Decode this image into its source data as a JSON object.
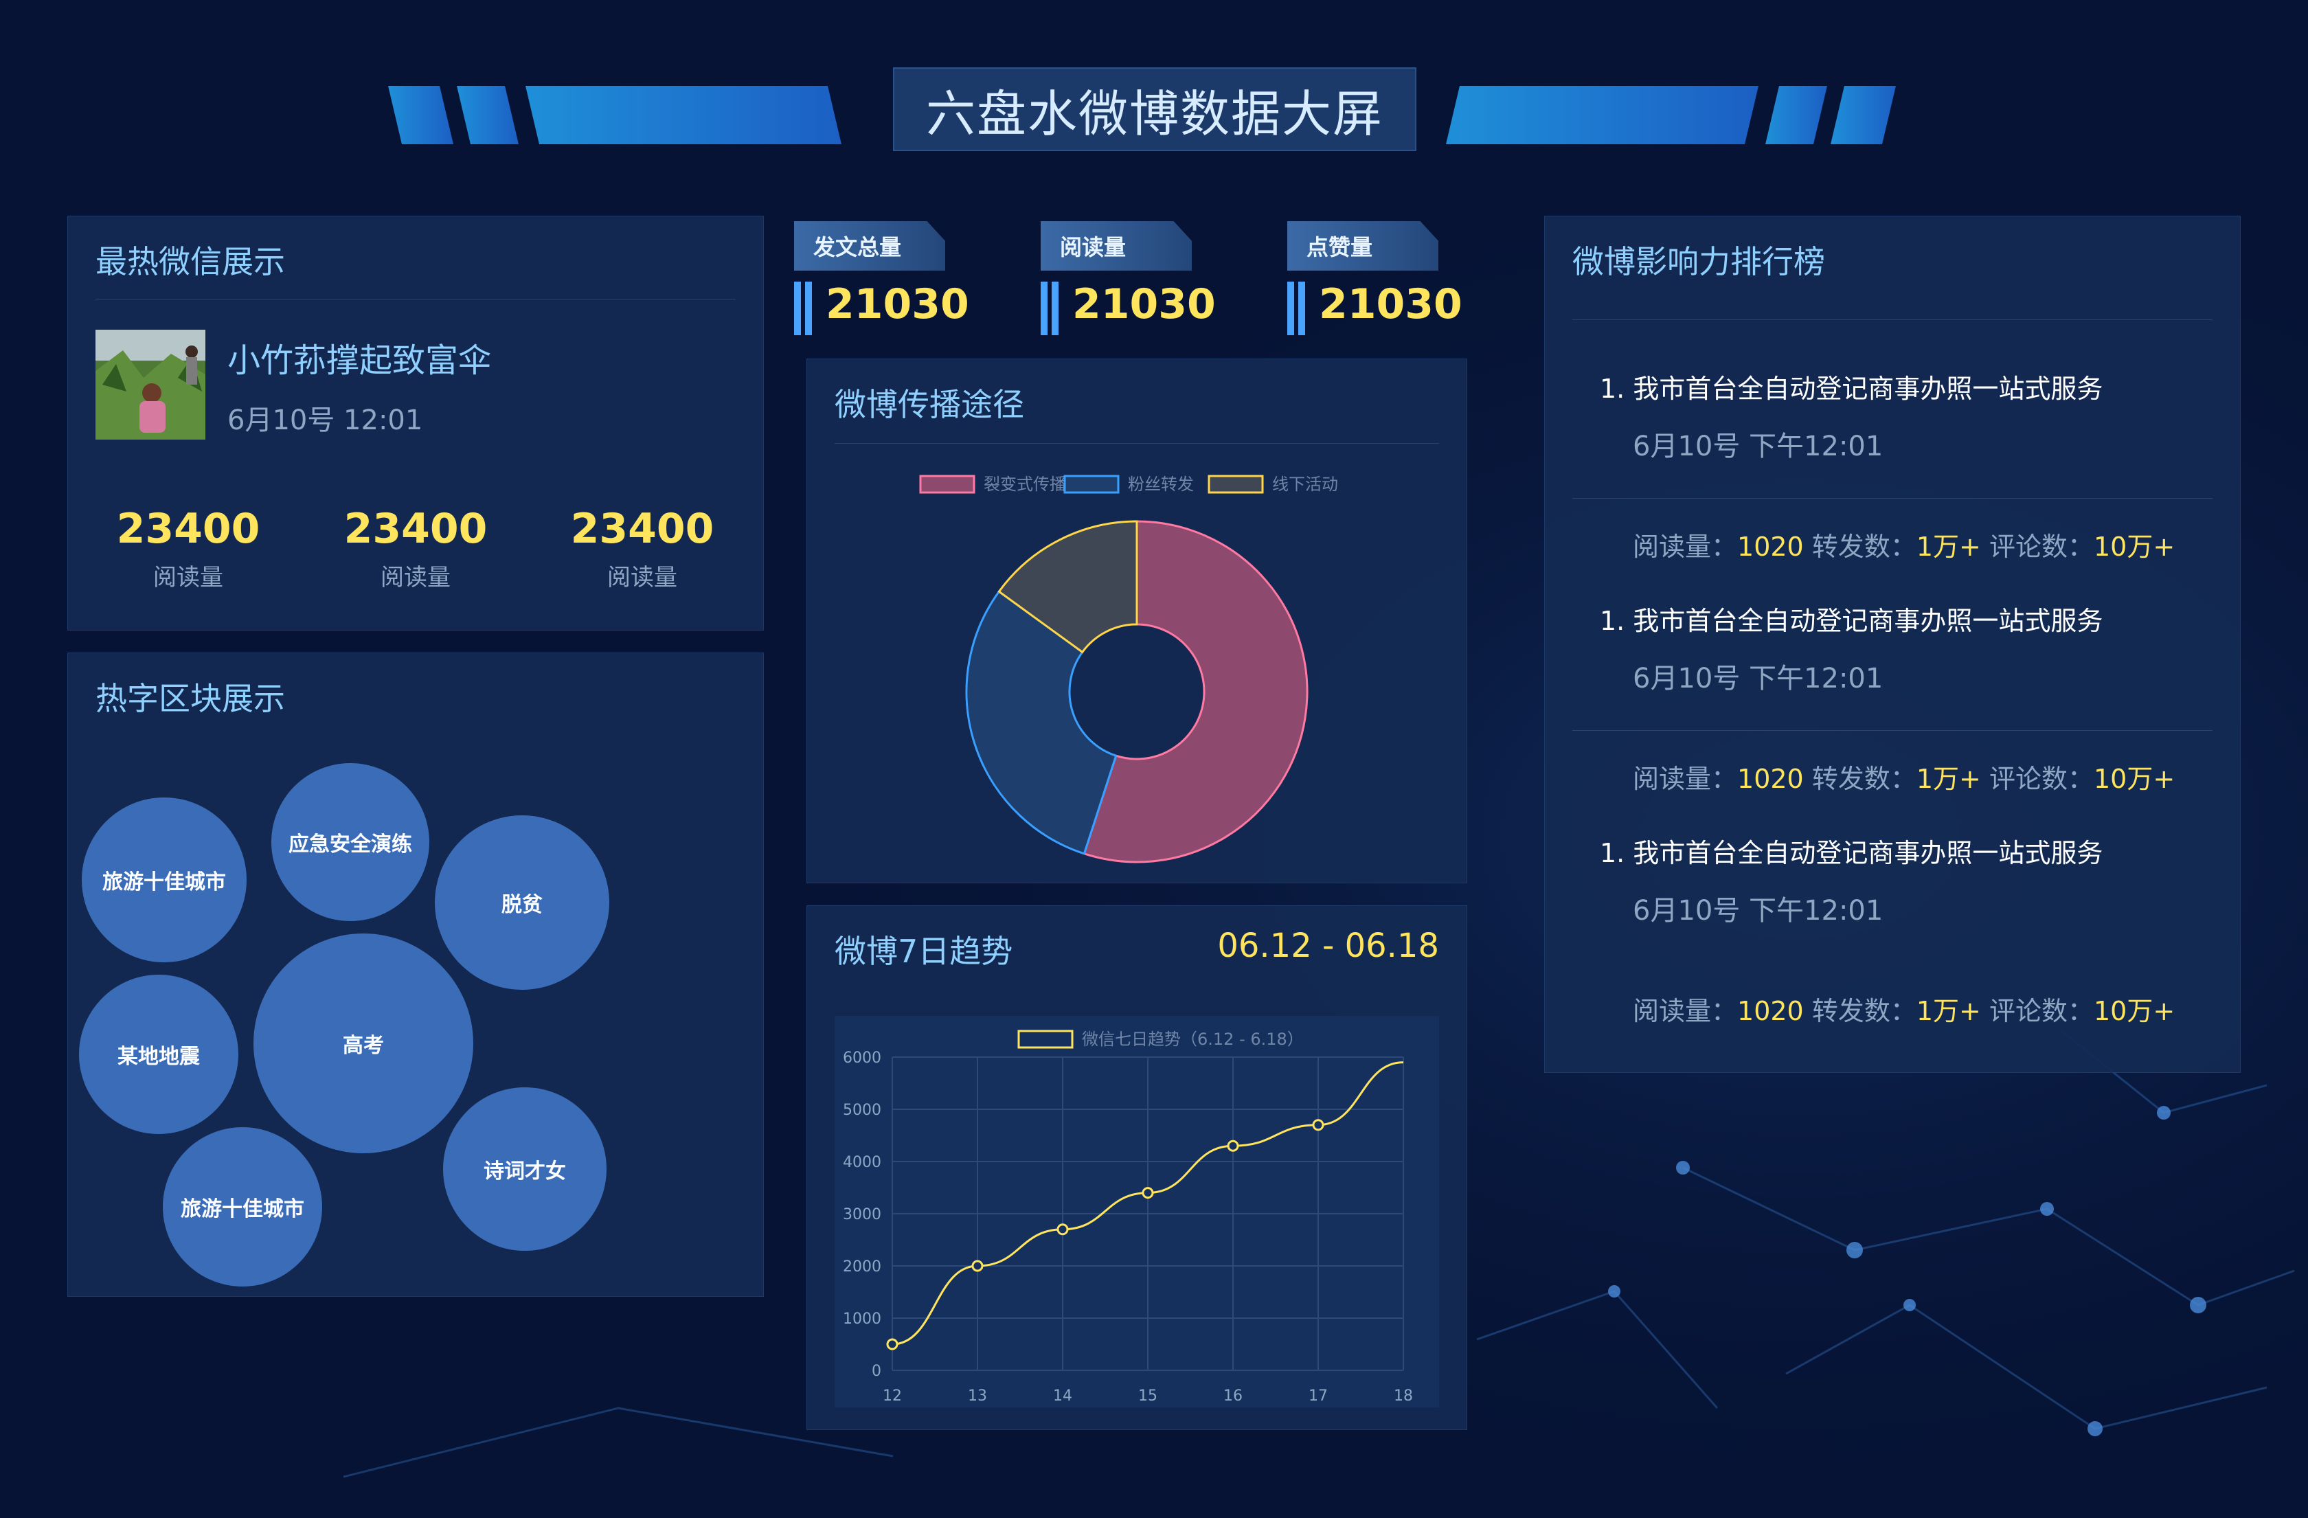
{
  "page": {
    "title": "六盘水微博数据大屏"
  },
  "hot_weixin": {
    "title": "最热微信展示",
    "post_title": "小竹荪撑起致富伞",
    "post_date": "6月10号 12:01",
    "stats": [
      {
        "value": "23400",
        "label": "阅读量"
      },
      {
        "value": "23400",
        "label": "阅读量"
      },
      {
        "value": "23400",
        "label": "阅读量"
      }
    ]
  },
  "hot_words": {
    "title": "热字区块展示",
    "words": [
      "旅游十佳城市",
      "应急安全演练",
      "脱贫",
      "某地地震",
      "高考",
      "诗词才女",
      "旅游十佳城市"
    ]
  },
  "kpis": [
    {
      "label": "发文总量",
      "value": "21030"
    },
    {
      "label": "阅读量",
      "value": "21030"
    },
    {
      "label": "点赞量",
      "value": "21030"
    }
  ],
  "spread": {
    "title": "微博传播途径",
    "chart_data": {
      "type": "pie",
      "categories": [
        "裂变式传播",
        "粉丝转发",
        "线下活动"
      ],
      "values": [
        55,
        30,
        15
      ],
      "colors": [
        "#8d4a6e",
        "#1e3f6e",
        "#404754"
      ],
      "border_colors": [
        "#ff7aa3",
        "#3aa0ff",
        "#ffd54a"
      ],
      "legend": "top"
    }
  },
  "trend": {
    "title": "微博7日趋势",
    "range": "06.12 - 06.18",
    "chart_data": {
      "type": "line",
      "x": [
        12,
        13,
        14,
        15,
        16,
        17,
        18
      ],
      "series": [
        {
          "name": "微信七日趋势（6.12 - 6.18）",
          "values": [
            500,
            2000,
            2700,
            3400,
            4300,
            4700,
            5900
          ]
        }
      ],
      "ylim": [
        0,
        6000
      ],
      "yticks": [
        0,
        1000,
        2000,
        3000,
        4000,
        5000,
        6000
      ],
      "line_color": "#ffe45e",
      "grid": true,
      "legend": "top"
    }
  },
  "ranking": {
    "title": "微博影响力排行榜",
    "read_label": "阅读量：",
    "forward_label": "转发数：",
    "comment_label": "评论数：",
    "items": [
      {
        "index": "1.",
        "title": "我市首台全自动登记商事办照一站式服务",
        "date": "6月10号 下午12:01",
        "reads": "1020",
        "forwards": "1万+",
        "comments": "10万+"
      },
      {
        "index": "1.",
        "title": "我市首台全自动登记商事办照一站式服务",
        "date": "6月10号 下午12:01",
        "reads": "1020",
        "forwards": "1万+",
        "comments": "10万+"
      },
      {
        "index": "1.",
        "title": "我市首台全自动登记商事办照一站式服务",
        "date": "6月10号 下午12:01",
        "reads": "1020",
        "forwards": "1万+",
        "comments": "10万+"
      }
    ]
  }
}
